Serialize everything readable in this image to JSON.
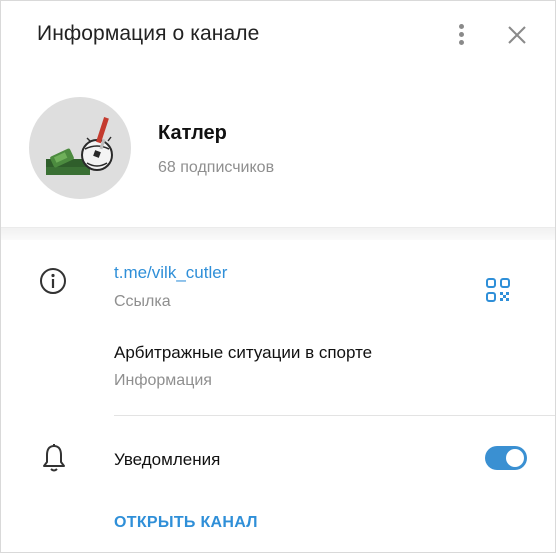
{
  "header": {
    "title": "Информация о канале",
    "menu_icon": "more-vertical-icon",
    "close_icon": "close-icon"
  },
  "channel": {
    "name": "Катлер",
    "subscribers": "68 подписчиков",
    "avatar_icon": "money-ball-avatar"
  },
  "info": {
    "link": "t.me/vilk_cutler",
    "link_label": "Ссылка",
    "description": "Арбитражные ситуации в спорте",
    "description_label": "Информация",
    "qr_icon": "qr-code-icon",
    "info_icon": "info-icon"
  },
  "notifications": {
    "label": "Уведомления",
    "enabled": true,
    "bell_icon": "bell-icon"
  },
  "actions": {
    "open_channel": "ОТКРЫТЬ КАНАЛ"
  },
  "colors": {
    "accent": "#2f8fd8",
    "toggle_on": "#3a90d2",
    "muted": "#8f8f8f"
  }
}
